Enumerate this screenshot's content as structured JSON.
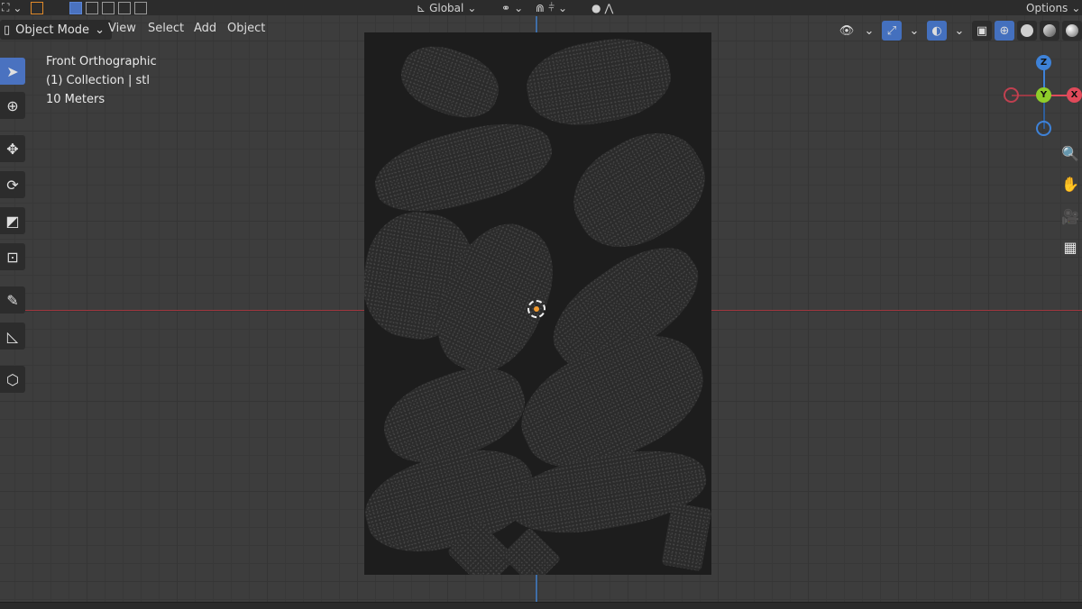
{
  "topbar": {
    "transform_orientation": "Global",
    "options_label": "Options"
  },
  "header": {
    "mode_label": "Object Mode",
    "menus": [
      "View",
      "Select",
      "Add",
      "Object"
    ]
  },
  "toolbar": {
    "tools": [
      "select-box-icon",
      "cursor-icon",
      "move-icon",
      "rotate-icon",
      "scale-icon",
      "transform-icon",
      "annotate-icon",
      "measure-icon",
      "add-cube-icon"
    ],
    "active_tool": "select-box-icon"
  },
  "viewport_info": {
    "view_name": "Front Orthographic",
    "collection": "(1) Collection | stl",
    "scale": "10 Meters"
  },
  "gizmo": {
    "z_label": "Z",
    "y_label": "Y",
    "x_label": "X"
  },
  "colors": {
    "accent": "#4a72c0",
    "x_axis": "#e04a5a",
    "y_axis": "#8fce2a",
    "z_axis": "#3e82d8",
    "origin": "#f29a2e"
  }
}
